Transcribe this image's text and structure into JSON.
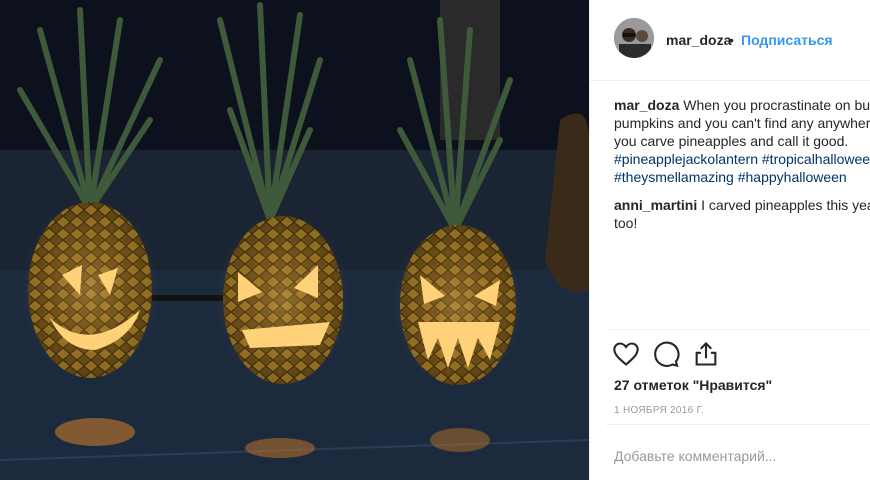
{
  "post": {
    "username": "mar_doza",
    "separator": "•",
    "follow_label": "Подписаться",
    "caption": {
      "username": "mar_doza",
      "lines": [
        "When you procrastinate on buy",
        "pumpkins and you can't find any anywhere",
        "you carve pineapples and call it good."
      ],
      "hashtags": [
        "#pineapplejackolantern #tropicalhallowee",
        "#theysmellamazing #happyhalloween"
      ]
    },
    "comment": {
      "username": "anni_martini",
      "lines": [
        "I carved pineapples this year",
        "too!"
      ]
    },
    "likes_label": "27 отметок \"Нравится\"",
    "date": "1 НОЯБРЯ 2016 Г.",
    "add_comment_placeholder": "Добавьте комментарий..."
  },
  "icons": {
    "like": "heart-icon",
    "comment": "comment-icon",
    "share": "share-icon"
  },
  "colors": {
    "username": "#262626",
    "follow": "#3897f0",
    "hashtag": "#003569",
    "muted": "#999999",
    "glow": "#ffb347"
  }
}
